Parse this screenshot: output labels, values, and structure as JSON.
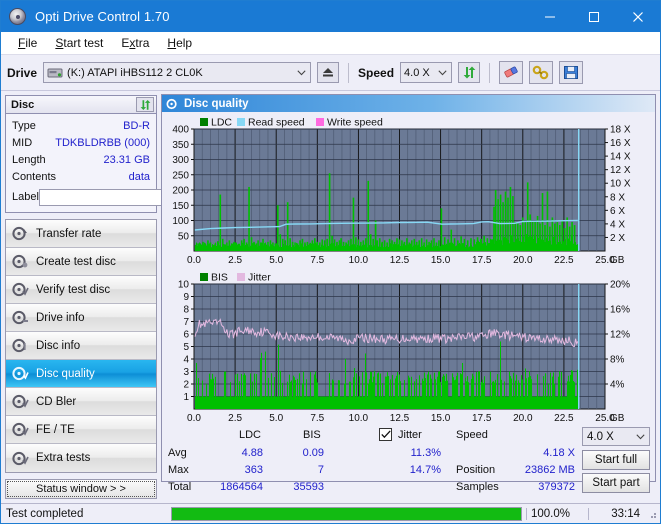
{
  "window": {
    "title": "Opti Drive Control 1.70",
    "icon": "disc-icon",
    "minimize": "minimize",
    "maximize": "maximize",
    "close": "close"
  },
  "menu": {
    "items": [
      {
        "label": "File",
        "accel": "F"
      },
      {
        "label": "Start test",
        "accel": "S"
      },
      {
        "label": "Extra",
        "accel": "x"
      },
      {
        "label": "Help",
        "accel": "H"
      }
    ]
  },
  "toolbar": {
    "drive_label": "Drive",
    "drive_value": "(K:)   ATAPI iHBS112  2 CL0K",
    "eject_icon": "eject-icon",
    "speed_label": "Speed",
    "speed_value": "4.0 X",
    "refresh_icon": "refresh-icon",
    "erase_icon": "eraser-icon",
    "tools_icon": "tools-icon",
    "save_icon": "save-icon"
  },
  "disc_panel": {
    "title": "Disc",
    "refresh_icon": "refresh-icon",
    "rows": [
      {
        "key": "Type",
        "value": "BD-R"
      },
      {
        "key": "MID",
        "value": "TDKBLDRBB (000)"
      },
      {
        "key": "Length",
        "value": "23.31 GB"
      },
      {
        "key": "Contents",
        "value": "data"
      }
    ],
    "label_key": "Label",
    "label_value": "",
    "label_placeholder": "",
    "label_button_icon": "disc-icon"
  },
  "nav": {
    "items": [
      {
        "label": "Transfer rate",
        "icon": "disc-transfer-icon",
        "active": false
      },
      {
        "label": "Create test disc",
        "icon": "disc-create-icon",
        "active": false
      },
      {
        "label": "Verify test disc",
        "icon": "disc-verify-icon",
        "active": false
      },
      {
        "label": "Drive info",
        "icon": "drive-info-icon",
        "active": false
      },
      {
        "label": "Disc info",
        "icon": "disc-info-icon",
        "active": false
      },
      {
        "label": "Disc quality",
        "icon": "disc-quality-icon",
        "active": true
      },
      {
        "label": "CD Bler",
        "icon": "cd-bler-icon",
        "active": false
      },
      {
        "label": "FE / TE",
        "icon": "fe-te-icon",
        "active": false
      },
      {
        "label": "Extra tests",
        "icon": "extra-tests-icon",
        "active": false
      }
    ],
    "status_window": "Status window > >"
  },
  "main": {
    "header_title": "Disc quality",
    "header_icon": "disc-quality-icon"
  },
  "stats": {
    "col_ldc": "LDC",
    "col_bis": "BIS",
    "jitter_label": "Jitter",
    "jitter_checked": true,
    "row_avg": "Avg",
    "row_max": "Max",
    "row_total": "Total",
    "avg_ldc": "4.88",
    "avg_bis": "0.09",
    "avg_jitter": "11.3%",
    "max_ldc": "363",
    "max_bis": "7",
    "max_jitter": "14.7%",
    "total_ldc": "1864564",
    "total_bis": "35593",
    "speed_label": "Speed",
    "speed_value": "4.18 X",
    "position_label": "Position",
    "position_value": "23862 MB",
    "samples_label": "Samples",
    "samples_value": "379372",
    "speed_select": "4.0 X",
    "start_full": "Start full",
    "start_part": "Start part"
  },
  "statusbar": {
    "text": "Test completed",
    "percent_label": "100.0%",
    "percent_value": 100,
    "elapsed": "33:14"
  },
  "colors": {
    "accent": "#1a7ad4",
    "plot_bg": "#6b7a96",
    "ldc_green": "#00c000",
    "read_speed": "#87d8f5",
    "write_speed": "#ff6ae0",
    "jitter_pink": "#e3b9e0",
    "value_blue": "#2222cc",
    "progress_green": "#12bb12"
  },
  "chart_data": [
    {
      "type": "line",
      "title": "LDC / Read speed",
      "xlabel": "GB",
      "ylabel": "LDC",
      "xlim": [
        0,
        25
      ],
      "ylim": [
        0,
        400
      ],
      "y2lim": [
        0,
        18
      ],
      "y2label": "X",
      "grid": true,
      "legend_position": "top-left",
      "legend": [
        {
          "name": "LDC",
          "color": "#008000"
        },
        {
          "name": "Read speed",
          "color": "#87d8f5"
        },
        {
          "name": "Write speed",
          "color": "#ff6ae0"
        }
      ],
      "xticks": [
        "0.0",
        "2.5",
        "5.0",
        "7.5",
        "10.0",
        "12.5",
        "15.0",
        "17.5",
        "20.0",
        "22.5",
        "25.0"
      ],
      "yticks": [
        "50",
        "100",
        "150",
        "200",
        "250",
        "300",
        "350",
        "400"
      ],
      "y2ticks": [
        "2 X",
        "4 X",
        "6 X",
        "8 X",
        "10 X",
        "12 X",
        "14 X",
        "16 X",
        "18 X"
      ],
      "data_end_x": 23.4,
      "series": [
        {
          "name": "LDC",
          "color": "#00c000",
          "kind": "bars",
          "x": [
            0.05,
            0.2,
            0.35,
            0.5,
            0.65,
            0.8,
            0.95,
            1.1,
            1.25,
            1.4,
            1.55,
            1.7,
            1.8,
            1.95,
            2.1,
            2.25,
            2.4,
            2.55,
            2.7,
            2.85,
            3.0,
            3.15,
            3.3,
            3.45,
            3.6,
            3.75,
            3.85,
            4.0,
            4.15,
            4.3,
            4.45,
            4.6,
            4.75,
            4.9,
            5.05,
            5.2,
            5.35,
            5.5,
            5.65,
            5.8,
            5.95,
            6.1,
            6.25,
            6.4,
            6.55,
            6.7,
            6.85,
            7.0,
            7.15,
            7.3,
            7.45,
            7.6,
            7.75,
            7.9,
            8.05,
            8.2,
            8.35,
            8.5,
            8.65,
            8.8,
            8.9,
            9.05,
            9.2,
            9.35,
            9.5,
            9.65,
            9.8,
            9.95,
            10.1,
            10.25,
            10.4,
            10.55,
            10.7,
            10.85,
            11.0,
            11.1,
            11.25,
            11.4,
            11.55,
            11.7,
            11.85,
            12.0,
            12.15,
            12.3,
            12.45,
            12.6,
            12.75,
            12.9,
            13.05,
            13.2,
            13.35,
            13.5,
            13.65,
            13.8,
            13.95,
            14.1,
            14.25,
            14.4,
            14.55,
            14.7,
            14.85,
            15.0,
            15.2,
            15.4,
            15.6,
            15.8,
            16.0,
            16.2,
            16.4,
            16.6,
            16.8,
            17.0,
            17.2,
            17.4,
            17.6,
            17.8,
            18.0,
            18.2,
            18.3,
            18.45,
            18.6,
            18.75,
            18.9,
            19.05,
            19.2,
            19.35,
            19.5,
            19.65,
            19.8,
            19.95,
            20.1,
            20.25,
            20.4,
            20.55,
            20.7,
            20.85,
            21.0,
            21.15,
            21.3,
            21.45,
            21.6,
            21.75,
            21.9,
            22.05,
            22.2,
            22.35,
            22.5,
            22.65,
            22.8,
            22.95,
            23.1,
            23.25,
            23.35
          ],
          "values": [
            20,
            25,
            18,
            30,
            22,
            35,
            28,
            20,
            25,
            32,
            185,
            40,
            22,
            28,
            35,
            25,
            30,
            22,
            18,
            35,
            40,
            28,
            210,
            45,
            30,
            25,
            35,
            28,
            40,
            22,
            30,
            35,
            28,
            25,
            150,
            55,
            40,
            35,
            160,
            42,
            30,
            28,
            25,
            35,
            40,
            28,
            30,
            25,
            35,
            42,
            30,
            28,
            38,
            35,
            40,
            255,
            50,
            38,
            30,
            35,
            42,
            30,
            28,
            35,
            40,
            175,
            45,
            38,
            30,
            35,
            42,
            230,
            55,
            40,
            100,
            35,
            42,
            30,
            35,
            28,
            40,
            35,
            30,
            42,
            38,
            35,
            30,
            42,
            28,
            35,
            40,
            30,
            35,
            42,
            28,
            38,
            30,
            35,
            42,
            28,
            35,
            140,
            45,
            38,
            70,
            42,
            35,
            48,
            40,
            35,
            42,
            38,
            45,
            40,
            50,
            42,
            38,
            145,
            200,
            170,
            185,
            160,
            195,
            175,
            210,
            180,
            95,
            90,
            85,
            110,
            95,
            225,
            120,
            100,
            95,
            115,
            90,
            190,
            85,
            195,
            80,
            110,
            90,
            95,
            85,
            100,
            75,
            110,
            80,
            95,
            85
          ]
        },
        {
          "name": "Read speed",
          "color": "#87d8f5",
          "kind": "line",
          "axis": "y2",
          "x": [
            0.05,
            1.0,
            1.8,
            2.5,
            3.4,
            4.3,
            5.2,
            5.6,
            6.2,
            7.1,
            8.0,
            8.9,
            9.8,
            10.7,
            11.5,
            12.4,
            13.3,
            14.2,
            15.1,
            15.6,
            16.0,
            17.0,
            17.5,
            17.9,
            18.6,
            19.5,
            20.0,
            20.4,
            21.3,
            22.2,
            23.0,
            23.35
          ],
          "values": [
            3.1,
            3.3,
            3.4,
            3.45,
            3.5,
            3.55,
            3.6,
            3.95,
            3.98,
            4.0,
            4.05,
            4.08,
            4.1,
            4.12,
            4.15,
            4.2,
            4.22,
            4.25,
            3.95,
            3.98,
            4.0,
            4.05,
            4.3,
            4.32,
            4.05,
            4.08,
            4.35,
            4.38,
            4.4,
            4.45,
            4.48,
            4.5
          ]
        }
      ]
    },
    {
      "type": "line",
      "title": "BIS / Jitter",
      "xlabel": "GB",
      "ylabel": "BIS",
      "xlim": [
        0,
        25
      ],
      "ylim": [
        0,
        10
      ],
      "y2lim": [
        0,
        20
      ],
      "y2label": "%",
      "grid": true,
      "legend_position": "top-left",
      "legend": [
        {
          "name": "BIS",
          "color": "#008000"
        },
        {
          "name": "Jitter",
          "color": "#e3b9e0"
        }
      ],
      "xticks": [
        "0.0",
        "2.5",
        "5.0",
        "7.5",
        "10.0",
        "12.5",
        "15.0",
        "17.5",
        "20.0",
        "22.5",
        "25.0"
      ],
      "yticks": [
        "1",
        "2",
        "3",
        "4",
        "5",
        "6",
        "7",
        "8",
        "9",
        "10"
      ],
      "y2ticks": [
        "4%",
        "8%",
        "12%",
        "16%",
        "20%"
      ],
      "data_end_x": 23.4,
      "series": [
        {
          "name": "BIS",
          "color": "#00c000",
          "kind": "bars",
          "baseline": 1.0,
          "x": [],
          "values": []
        },
        {
          "name": "Jitter",
          "color": "#e3b9e0",
          "kind": "line",
          "axis": "y2",
          "x": [
            0.05,
            0.3,
            0.6,
            0.9,
            1.2,
            1.5,
            1.8,
            2.1,
            2.4,
            2.7,
            3.0,
            3.4,
            3.8,
            4.2,
            4.6,
            5.0,
            5.4,
            5.8,
            6.3,
            6.8,
            7.3,
            7.8,
            8.3,
            8.8,
            9.3,
            9.8,
            10.3,
            10.8,
            11.3,
            11.8,
            12.3,
            12.8,
            13.3,
            13.8,
            14.3,
            14.8,
            15.3,
            15.8,
            16.3,
            16.8,
            17.3,
            17.8,
            18.3,
            18.8,
            19.3,
            19.8,
            20.3,
            20.8,
            21.3,
            21.8,
            22.3,
            22.8,
            23.2,
            23.35
          ],
          "values": [
            12.2,
            13.6,
            13.4,
            13.8,
            13.5,
            13.9,
            13.2,
            11.8,
            12.0,
            12.4,
            12.5,
            12.6,
            12.3,
            12.4,
            12.2,
            11.8,
            11.5,
            11.6,
            11.5,
            11.4,
            11.6,
            11.5,
            11.4,
            11.3,
            11.0,
            11.2,
            11.4,
            11.3,
            11.2,
            11.1,
            11.2,
            11.3,
            11.4,
            11.2,
            11.3,
            11.4,
            11.2,
            11.3,
            11.5,
            11.6,
            11.5,
            11.8,
            12.2,
            11.9,
            11.7,
            11.5,
            11.4,
            11.3,
            11.2,
            11.1,
            11.0,
            10.9,
            10.6,
            10.3
          ]
        }
      ]
    }
  ]
}
